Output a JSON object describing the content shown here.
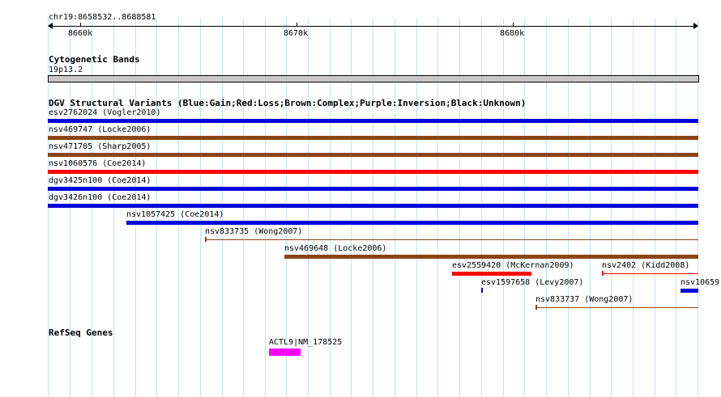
{
  "ruler": {
    "location": "chr19:8658532..8688581",
    "ticks": [
      "8660k",
      "8670k",
      "8680k"
    ]
  },
  "cytogenetic": {
    "title": "Cytogenetic Bands",
    "band": "19p13.2",
    "band_color": "#c8c8c8"
  },
  "dgv": {
    "title": "DGV Structural Variants (Blue:Gain;Red:Loss;Brown:Complex;Purple:Inversion;Black:Unknown)",
    "colors": {
      "gain": "#0000dd",
      "loss": "#ff0000",
      "complex": "#8b4513",
      "unknown": "#000000"
    },
    "variants": [
      {
        "label": "esv2762024 (Vogler2010)",
        "type": "gain"
      },
      {
        "label": "nsv469747 (Locke2006)",
        "type": "complex"
      },
      {
        "label": "nsv471705 (Sharp2005)",
        "type": "complex"
      },
      {
        "label": "nsv1060576 (Coe2014)",
        "type": "loss"
      },
      {
        "label": "dgv3425n100 (Coe2014)",
        "type": "gain"
      },
      {
        "label": "dgv3426n100 (Coe2014)",
        "type": "gain"
      },
      {
        "label": "nsv1057425 (Coe2014)",
        "type": "gain"
      },
      {
        "label": "nsv833735 (Wong2007)",
        "type": "complex"
      },
      {
        "label": "nsv469648 (Locke2006)",
        "type": "complex"
      },
      {
        "label": "esv2559420 (McKernan2009)",
        "type": "loss"
      },
      {
        "label": "nsv2402 (Kidd2008)",
        "type": "loss"
      },
      {
        "label": "esv1597658 (Levy2007)",
        "type": "gain"
      },
      {
        "label": "nsv10659",
        "type": "gain"
      },
      {
        "label": "nsv833737 (Wong2007)",
        "type": "complex"
      }
    ]
  },
  "refseq": {
    "title": "RefSeq Genes",
    "genes": [
      {
        "label": "ACTL9|NM_178525",
        "color": "#ff00ff"
      }
    ]
  }
}
